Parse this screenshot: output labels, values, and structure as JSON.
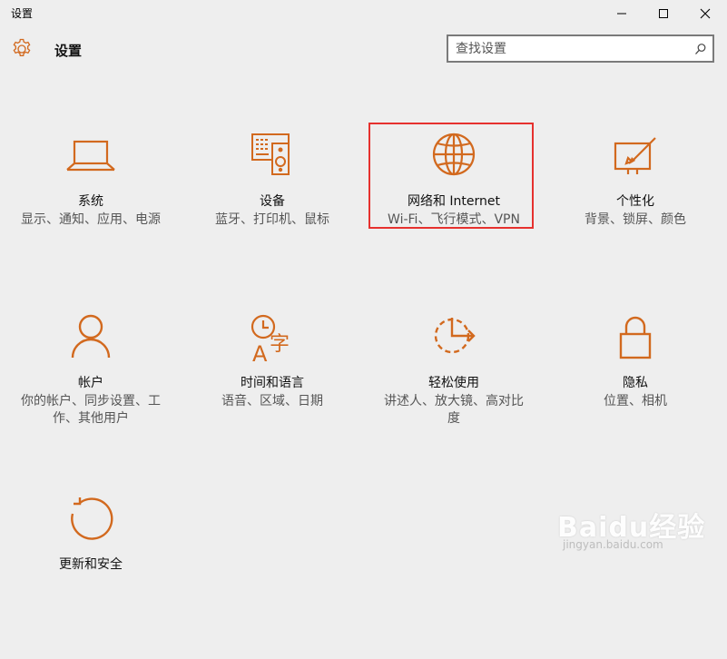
{
  "window": {
    "title": "设置"
  },
  "header": {
    "title": "设置"
  },
  "search": {
    "placeholder": "查找设置"
  },
  "tiles": [
    {
      "name": "系统",
      "desc": "显示、通知、应用、电源",
      "icon": "laptop-icon"
    },
    {
      "name": "设备",
      "desc": "蓝牙、打印机、鼠标",
      "icon": "devices-icon"
    },
    {
      "name": "网络和 Internet",
      "desc": "Wi-Fi、飞行模式、VPN",
      "icon": "globe-icon"
    },
    {
      "name": "个性化",
      "desc": "背景、锁屏、颜色",
      "icon": "paint-brush-icon"
    },
    {
      "name": "帐户",
      "desc": "你的帐户、同步设置、工作、其他用户",
      "icon": "person-icon"
    },
    {
      "name": "时间和语言",
      "desc": "语音、区域、日期",
      "icon": "time-language-icon"
    },
    {
      "name": "轻松使用",
      "desc": "讲述人、放大镜、高对比度",
      "icon": "ease-of-access-icon"
    },
    {
      "name": "隐私",
      "desc": "位置、相机",
      "icon": "lock-icon"
    },
    {
      "name": "更新和安全",
      "desc": "",
      "icon": "update-icon"
    }
  ],
  "watermark": {
    "brand": "Baidu经验",
    "url": "jingyan.baidu.com"
  },
  "colors": {
    "accent": "#d2691e",
    "highlight_border": "#e6312e",
    "background": "#eeeeee"
  }
}
